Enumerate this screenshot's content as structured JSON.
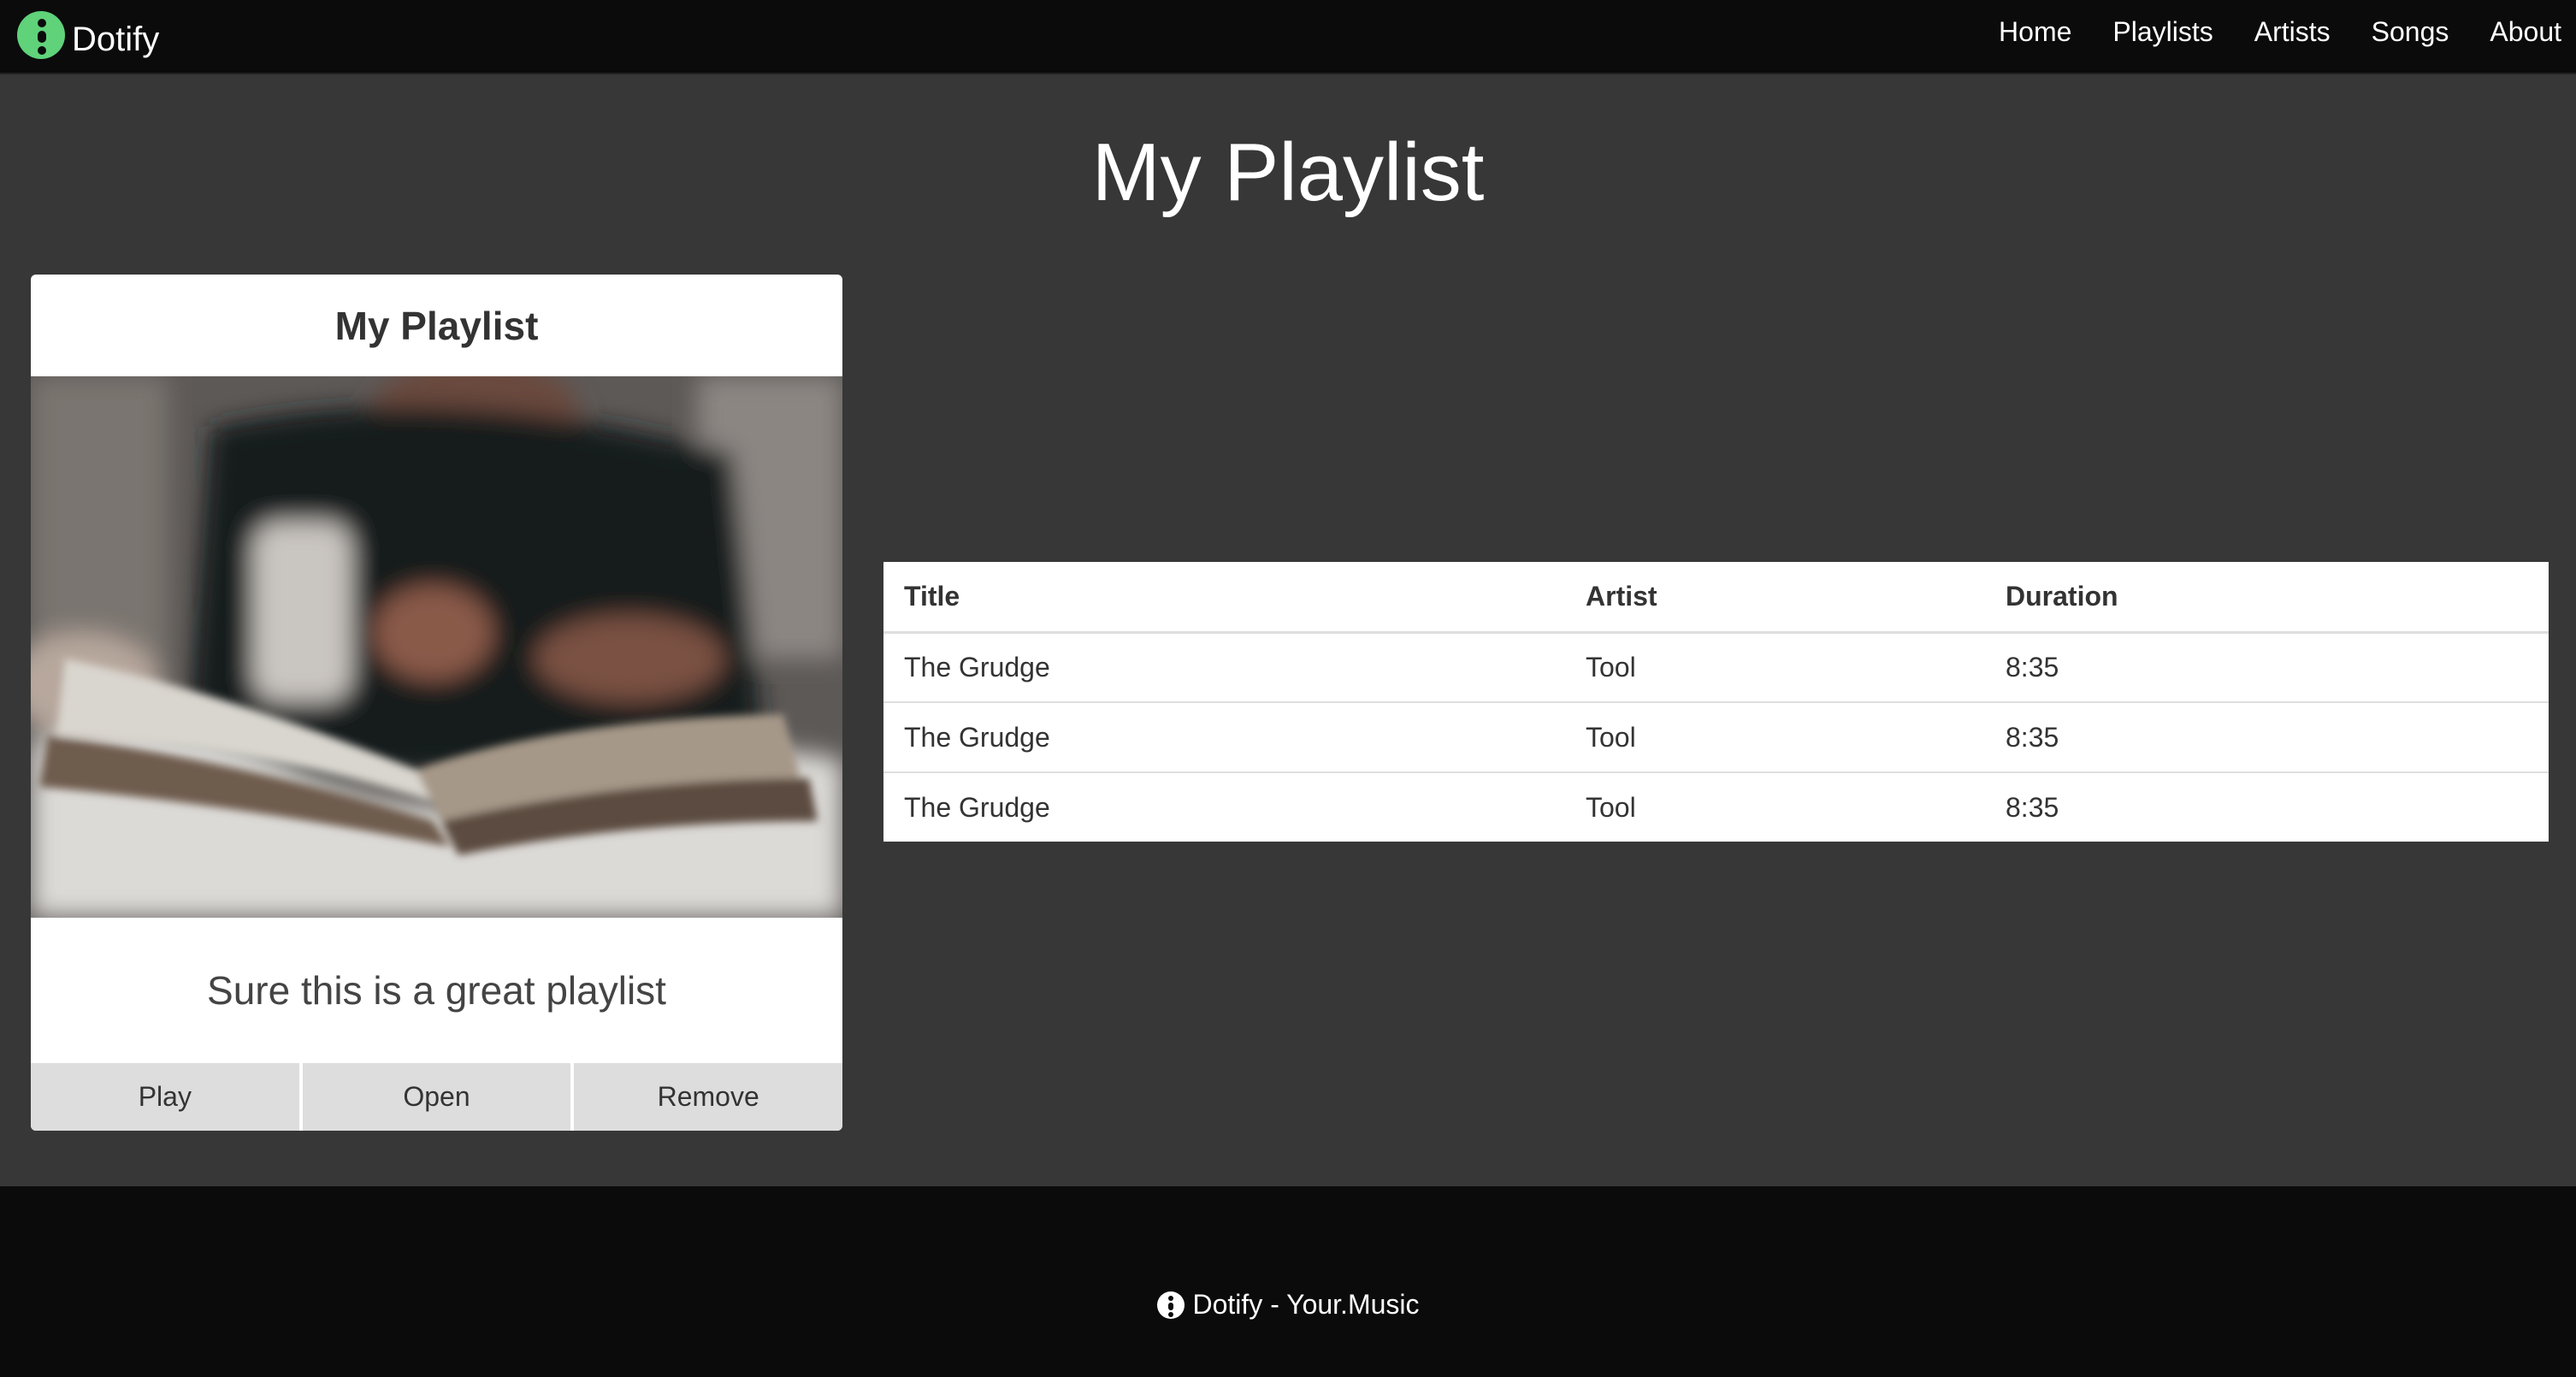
{
  "app": {
    "brand": "Dotify",
    "logo_icon": "dotify-logo-icon",
    "accent": "#5fd27a"
  },
  "nav": {
    "items": [
      {
        "label": "Home"
      },
      {
        "label": "Playlists"
      },
      {
        "label": "Artists"
      },
      {
        "label": "Songs"
      },
      {
        "label": "About"
      }
    ]
  },
  "page": {
    "title": "My Playlist"
  },
  "playlist_card": {
    "title": "My Playlist",
    "image_description": "cover-photo",
    "description": "Sure this is a great playlist",
    "buttons": {
      "play": "Play",
      "open": "Open",
      "remove": "Remove"
    }
  },
  "songs_table": {
    "headers": {
      "title": "Title",
      "artist": "Artist",
      "duration": "Duration"
    },
    "rows": [
      {
        "title": "The Grudge",
        "artist": "Tool",
        "duration": "8:35"
      },
      {
        "title": "The Grudge",
        "artist": "Tool",
        "duration": "8:35"
      },
      {
        "title": "The Grudge",
        "artist": "Tool",
        "duration": "8:35"
      }
    ]
  },
  "footer": {
    "text": "Dotify - Your.Music"
  }
}
